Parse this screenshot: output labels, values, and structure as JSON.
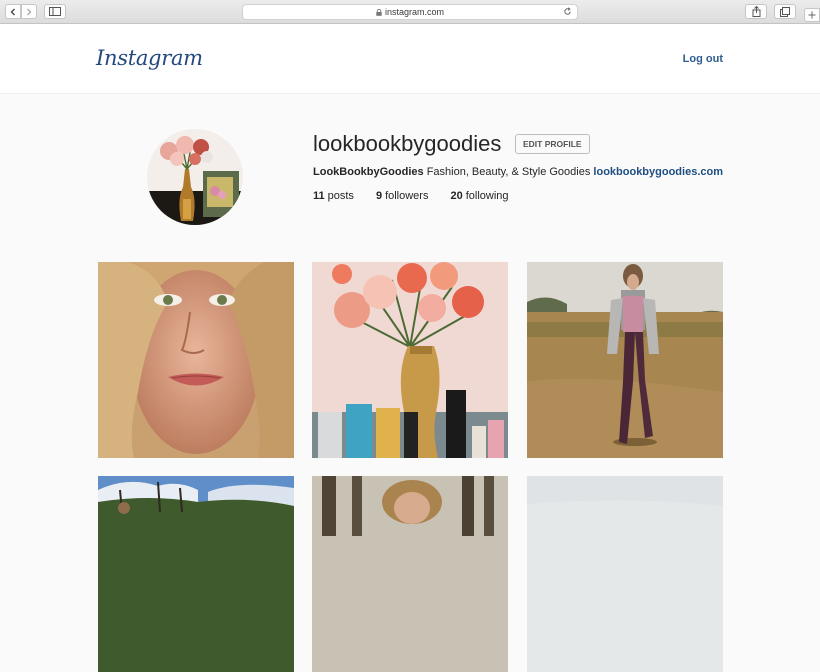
{
  "browser": {
    "url": "instagram.com"
  },
  "header": {
    "logo": "Instagram",
    "logout_label": "Log out"
  },
  "profile": {
    "username": "lookbookbygoodies",
    "edit_label": "EDIT PROFILE",
    "full_name": "LookBookbyGoodies",
    "bio": "Fashion, Beauty, & Style Goodies",
    "website": "lookbookbygoodies.com",
    "stats": {
      "posts_count": "11",
      "posts_label": "posts",
      "followers_count": "9",
      "followers_label": "followers",
      "following_count": "20",
      "following_label": "following"
    }
  },
  "grid": {
    "posts": [
      "selfie",
      "flowers-and-cosmetics",
      "field-walk",
      "hills-landscape",
      "trees-portrait",
      "sky"
    ]
  },
  "colors": {
    "logo": "#23497e",
    "link": "#1f4e82",
    "page_bg": "#fafafa"
  }
}
